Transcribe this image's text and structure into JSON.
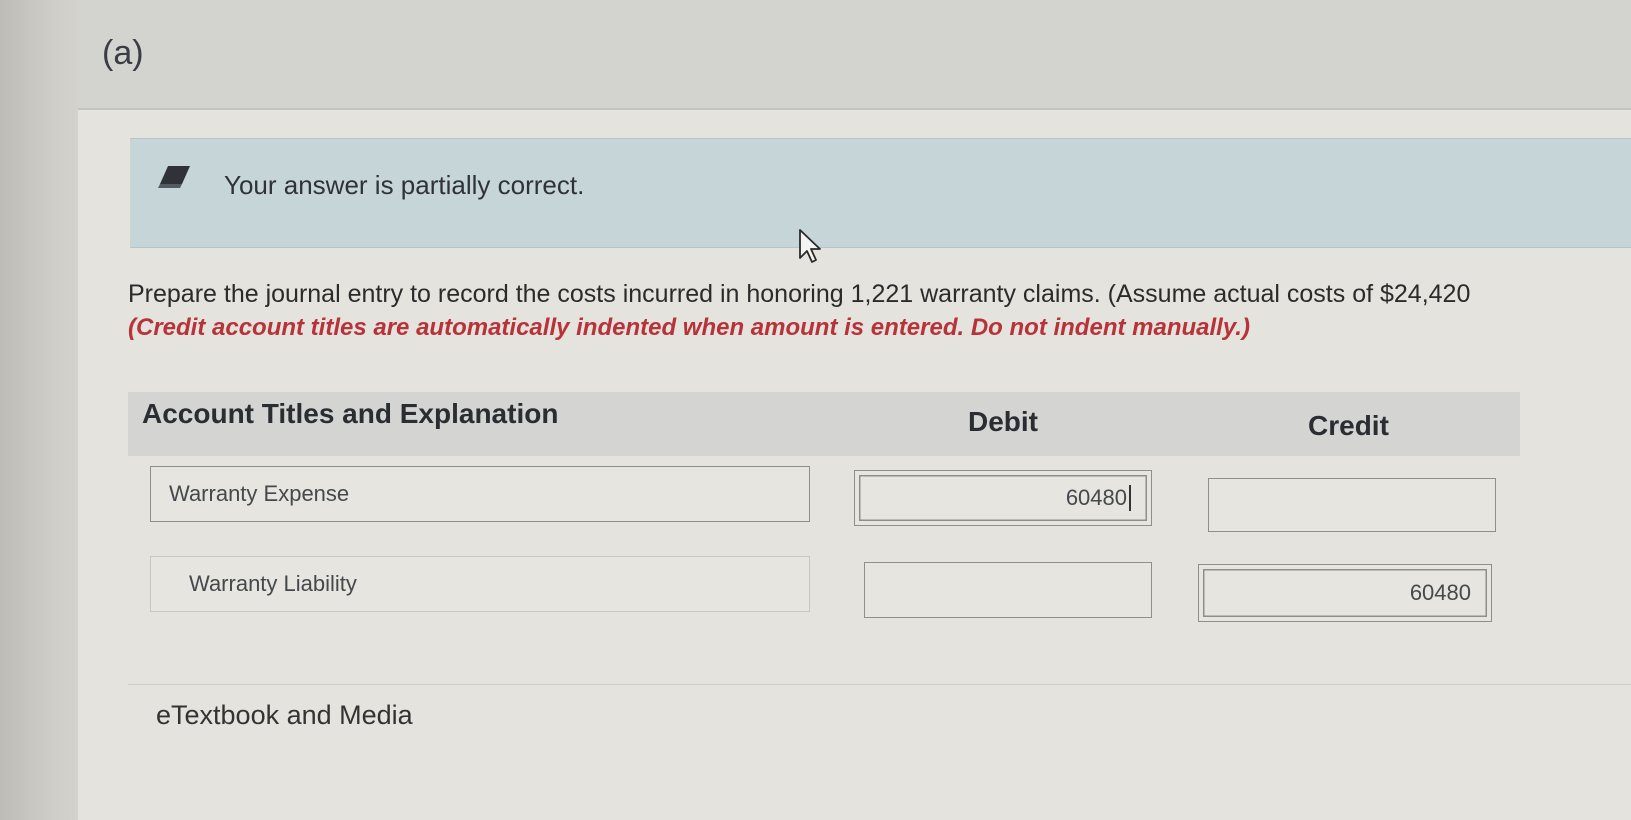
{
  "part": {
    "label": "(a)"
  },
  "feedback": {
    "message": "Your answer is partially correct.",
    "icon": "eraser-icon"
  },
  "question": {
    "text": "Prepare the journal entry to record the costs incurred in honoring 1,221 warranty claims. (Assume actual costs of $24,420",
    "note": "(Credit account titles are automatically indented when amount is entered. Do not indent manually.)"
  },
  "table": {
    "headers": {
      "account": "Account Titles and Explanation",
      "debit": "Debit",
      "credit": "Credit"
    },
    "rows": [
      {
        "account": "Warranty Expense",
        "debit": "60480",
        "credit": ""
      },
      {
        "account": "Warranty Liability",
        "debit": "",
        "credit": "60480"
      }
    ]
  },
  "links": {
    "etextbook": "eTextbook and Media"
  },
  "colors": {
    "feedback_background": "#c6d6d8",
    "note_red": "#b8323a",
    "header_background": "#d4d5d2"
  }
}
